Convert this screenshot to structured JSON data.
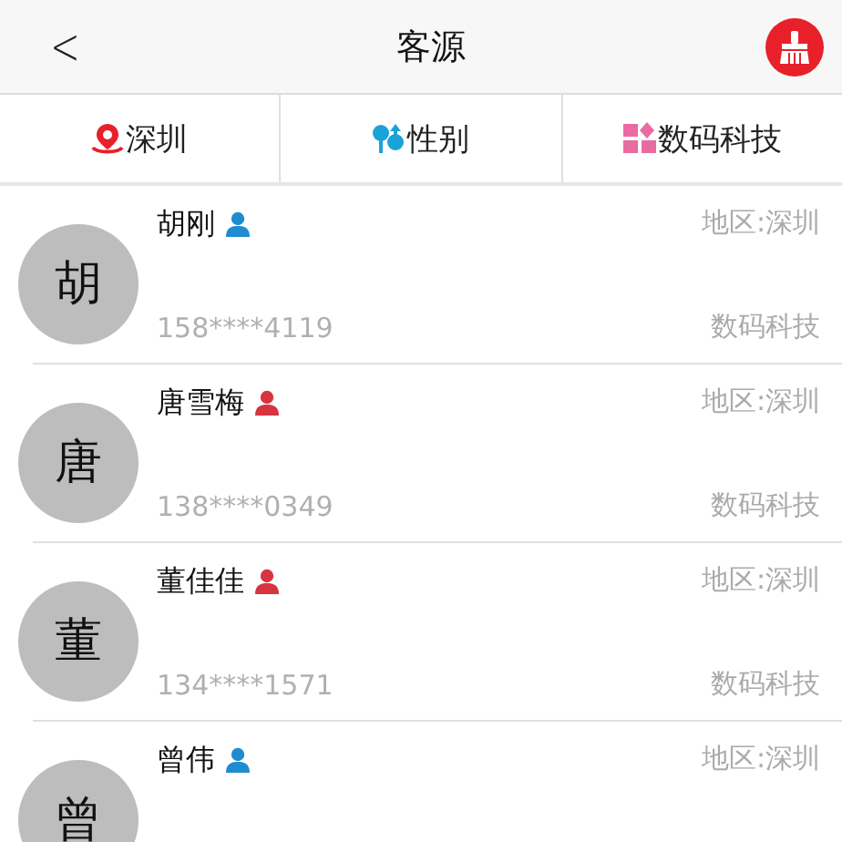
{
  "header": {
    "back": "<",
    "title": "客源"
  },
  "filters": [
    {
      "label": "深圳",
      "kind": "location"
    },
    {
      "label": "性别",
      "kind": "gender"
    },
    {
      "label": "数码科技",
      "kind": "category"
    }
  ],
  "customers": [
    {
      "avatar": "胡",
      "name": "胡刚",
      "kind": "male",
      "region": "地区:深圳",
      "phone": "158****4119",
      "company": "数码科技"
    },
    {
      "avatar": "唐",
      "name": "唐雪梅",
      "kind": "female",
      "region": "地区:深圳",
      "phone": "138****0349",
      "company": "数码科技"
    },
    {
      "avatar": "董",
      "name": "董佳佳",
      "kind": "female",
      "region": "地区:深圳",
      "phone": "134****1571",
      "company": "数码科技"
    },
    {
      "avatar": "曾",
      "name": "曾伟",
      "kind": "male",
      "region": "地区:深圳"
    }
  ]
}
